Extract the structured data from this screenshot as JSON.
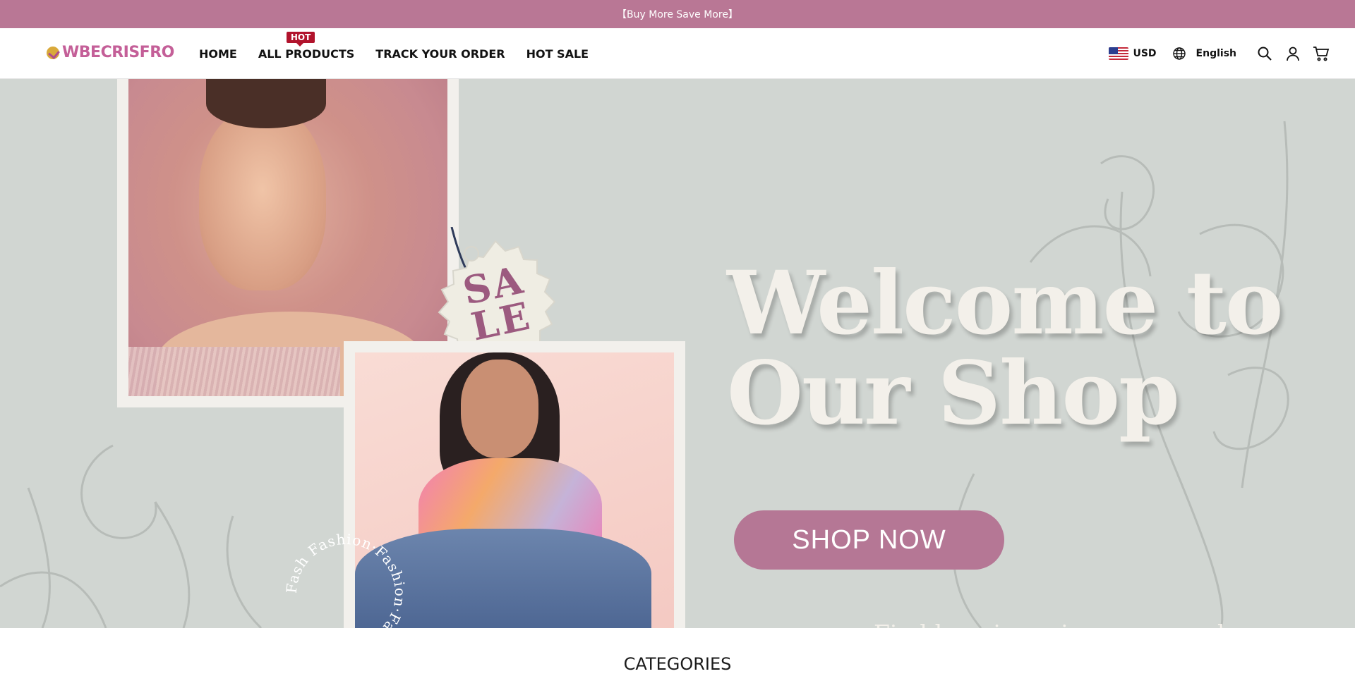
{
  "announcement": {
    "text": "【Buy More Save More】"
  },
  "header": {
    "logo_text": "WBECRISFRO",
    "nav": [
      {
        "label": "HOME"
      },
      {
        "label": "ALL PRODUCTS",
        "badge": "HOT"
      },
      {
        "label": "TRACK YOUR ORDER"
      },
      {
        "label": "HOT SALE"
      }
    ],
    "currency": {
      "flag": "us-flag-icon",
      "label": "USD"
    },
    "language": {
      "icon": "globe-icon",
      "label": "English"
    },
    "icons": [
      "search-icon",
      "account-icon",
      "cart-icon"
    ]
  },
  "hero": {
    "sale_tag": "SA LE",
    "circle_text": "Fash Fashion·Fashion·Fashion·",
    "headline_line1": "Welcome to",
    "headline_line2": "Our Shop",
    "cta_label": "SHOP NOW",
    "tagline": "Find happiness in every purchase."
  },
  "sections": {
    "categories_title": "CATEGORIES"
  },
  "colors": {
    "announcement_bg": "#b97795",
    "brand": "#c45f98",
    "hot_badge": "#b1132c",
    "hero_bg": "#d1d6d2",
    "cta_bg": "#b57795"
  }
}
